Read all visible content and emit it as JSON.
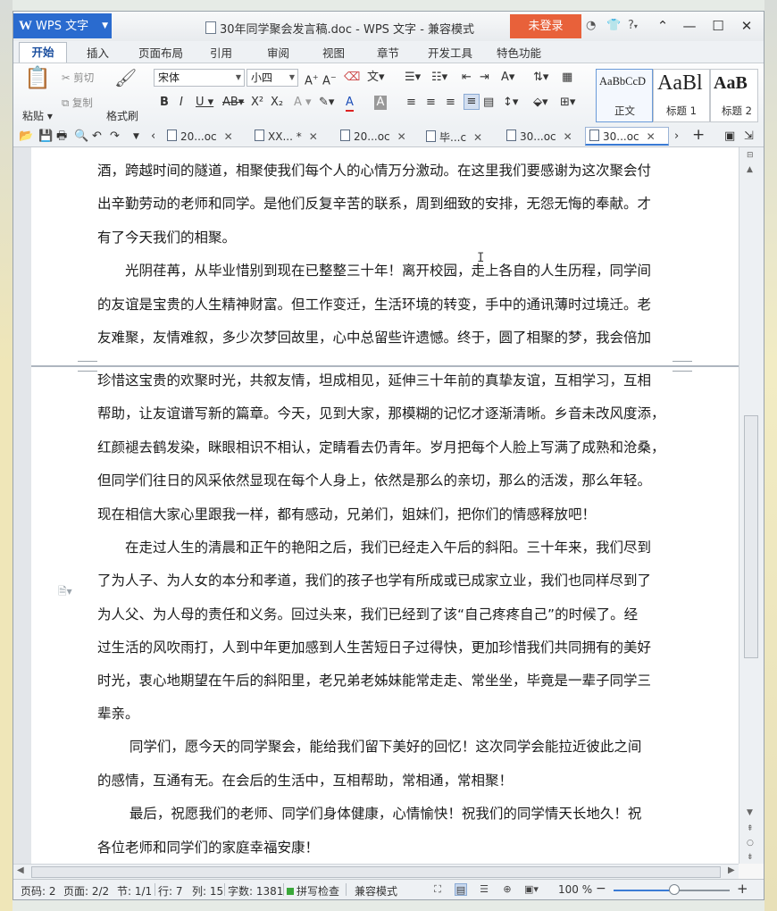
{
  "app": {
    "logo_label": "WPS 文字",
    "window_title": "30年同学聚会发言稿.doc - WPS 文字 - 兼容模式",
    "login_label": "未登录",
    "help_label": "?"
  },
  "ribbon_tabs": [
    "开始",
    "插入",
    "页面布局",
    "引用",
    "审阅",
    "视图",
    "章节",
    "开发工具",
    "特色功能"
  ],
  "ribbon": {
    "paste_label": "粘贴",
    "cut_label": "剪切",
    "copy_label": "复制",
    "format_painter_label": "格式刷",
    "font_name": "宋体",
    "font_size": "小四",
    "styles": [
      {
        "preview": "AaBbCcD",
        "name": "正文"
      },
      {
        "preview": "AaBl",
        "name": "标题 1"
      },
      {
        "preview": "AaB",
        "name": "标题 2"
      }
    ]
  },
  "doc_tabs": [
    {
      "label": "20...oc",
      "active": false
    },
    {
      "label": "XX... *",
      "active": false
    },
    {
      "label": "20...oc",
      "active": false
    },
    {
      "label": "毕...c",
      "active": false
    },
    {
      "label": "30...oc",
      "active": false
    },
    {
      "label": "30...oc",
      "active": true
    }
  ],
  "document": {
    "lines": [
      "酒，跨越时间的隧道，相聚使我们每个人的心情万分激动。在这里我们要感谢为这次聚会付",
      "出辛勤劳动的老师和同学。是他们反复辛苦的联系，周到细致的安排，无怨无悔的奉献。才",
      "有了今天我们的相聚。",
      "　　光阴荏苒，从毕业惜别到现在已整整三十年！离开校园，走上各自的人生历程，同学间",
      "的友谊是宝贵的人生精神财富。但工作变迁，生活环境的转变，手中的通讯薄时过境迁。老",
      "友难聚，友情难叙，多少次梦回故里，心中总留些许遗憾。终于，圆了相聚的梦，我会倍加",
      "珍惜这宝贵的欢聚时光，共叙友情，坦成相见，延伸三十年前的真挚友谊，互相学习，互相",
      "帮助，让友谊谱写新的篇章。今天，见到大家，那模糊的记忆才逐渐清晰。乡音未改风度添，",
      "红颜褪去鹤发染，眯眼相识不相认，定睛看去仍青年。岁月把每个人脸上写满了成熟和沧桑，",
      "但同学们往日的风采依然显现在每个人身上，依然是那么的亲切，那么的活泼，那么年轻。",
      "现在相信大家心里跟我一样，都有感动，兄弟们，姐妹们，把你们的情感释放吧！",
      "　　在走过人生的清晨和正午的艳阳之后，我们已经走入午后的斜阳。三十年来，我们尽到",
      "了为人子、为人女的本分和孝道，我们的孩子也学有所成或已成家立业，我们也同样尽到了",
      "为人父、为人母的责任和义务。回过头来，我们已经到了该“自己疼疼自己”的时候了。经",
      "过生活的风吹雨打，人到中年更加感到人生苦短日子过得快，更加珍惜我们共同拥有的美好",
      "时光，衷心地期望在午后的斜阳里，老兄弟老姊妹能常走走、常坐坐，毕竟是一辈子同学三",
      "辈亲。",
      "　　 同学们，愿今天的同学聚会，能给我们留下美好的回忆！这次同学会能拉近彼此之间",
      "的感情，互通有无。在会后的生活中，互相帮助，常相通，常相聚！",
      "　　 最后，祝愿我们的老师、同学们身体健康，心情愉快！祝我们的同学情天长地久！祝",
      "各位老师和同学们的家庭幸福安康！"
    ]
  },
  "status": {
    "page_num": "页码: 2",
    "pages": "页面: 2/2",
    "section": "节: 1/1",
    "row": "行: 7",
    "col": "列: 15",
    "word_count": "字数: 1381",
    "spell_check": "拼写检查",
    "mode": "兼容模式",
    "zoom": "100 %",
    "zoom_fraction": 0.5,
    "accent_color": "#2a6bcf"
  }
}
